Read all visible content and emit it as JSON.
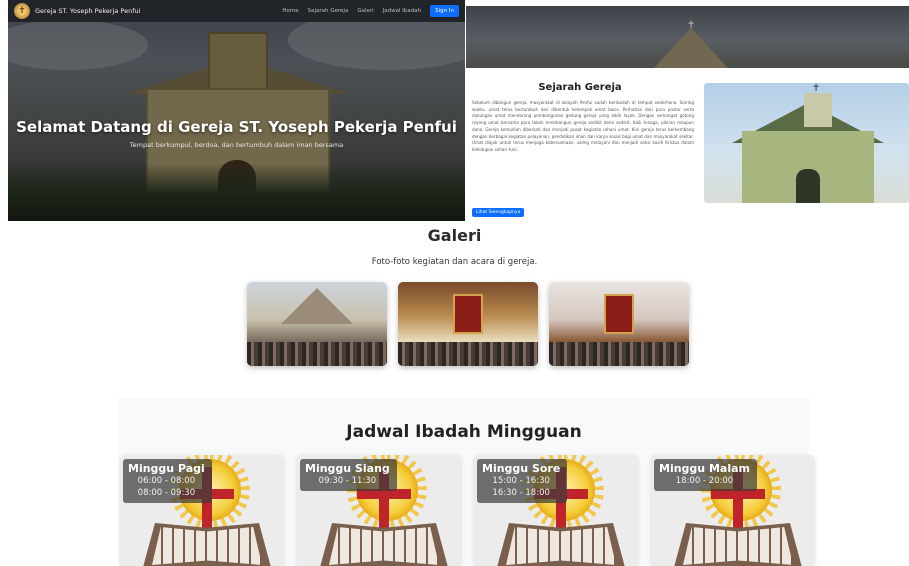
{
  "navbar": {
    "logo_glyph": "✝",
    "brand": "Gereja ST. Yoseph Pekerja Penfui",
    "links": [
      "Home",
      "Sejarah Gereja",
      "Galeri",
      "Jadwal Ibadah"
    ],
    "signin_label": "Sign In"
  },
  "hero": {
    "title": "Selamat Datang di Gereja ST. Yoseph Pekerja Penfui",
    "subtitle": "Tempat berkumpul, berdoa, dan bertumbuh dalam iman bersama"
  },
  "history": {
    "title": "Sejarah Gereja",
    "body": "Sebelum dibangun gereja, masyarakat di wilayah Penfui sudah beribadah di tempat sederhana. Seiring waktu, umat terus bertumbuh dan dibentuk kelompok umat basis. Perhatian dari para pastor serta dukungan umat mendorong pembangunan gedung gereja yang lebih layak. Dengan semangat gotong royong umat bersama para tokoh membangun gereja sedikit demi sedikit, baik tenaga, pikiran maupun dana. Gereja kemudian diberkati dan menjadi pusat kegiatan rohani umat. Kini gereja terus berkembang dengan berbagai kegiatan pelayanan, pendidikan iman dan karya sosial bagi umat dan masyarakat sekitar. Umat diajak untuk terus menjaga kebersamaan, saling melayani dan menjadi saksi kasih Kristus dalam kehidupan sehari-hari.",
    "button_label": "Lihat Selengkapnya"
  },
  "gallery": {
    "title": "Galeri",
    "subtitle": "Foto-foto kegiatan dan acara di gereja."
  },
  "schedule": {
    "title": "Jadwal Ibadah Mingguan",
    "cards": [
      {
        "name": "Minggu Pagi",
        "times": [
          "06:00 - 08:00",
          "08:00 - 09:30"
        ]
      },
      {
        "name": "Minggu Siang",
        "times": [
          "09:30 - 11:30"
        ]
      },
      {
        "name": "Minggu Sore",
        "times": [
          "15:00 - 16:30",
          "16:30 - 18:00"
        ]
      },
      {
        "name": "Minggu Malam",
        "times": [
          "18:00 - 20:00"
        ]
      }
    ]
  }
}
